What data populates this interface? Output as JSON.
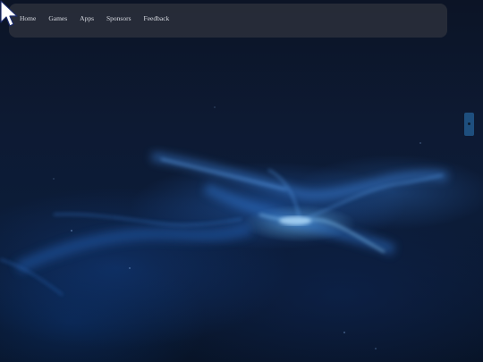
{
  "nav": {
    "items": [
      {
        "label": "Home"
      },
      {
        "label": "Games"
      },
      {
        "label": "Apps"
      },
      {
        "label": "Sponsors"
      },
      {
        "label": "Feedback"
      }
    ]
  },
  "icons": {
    "side_tab": "side-expand-icon",
    "cursor": "mouse-pointer-icon"
  },
  "colors": {
    "background": "#0a1222",
    "nav_bg": "#3c3e46",
    "nav_text": "#d8dbe2",
    "accent_tab": "#1e4f7e"
  }
}
